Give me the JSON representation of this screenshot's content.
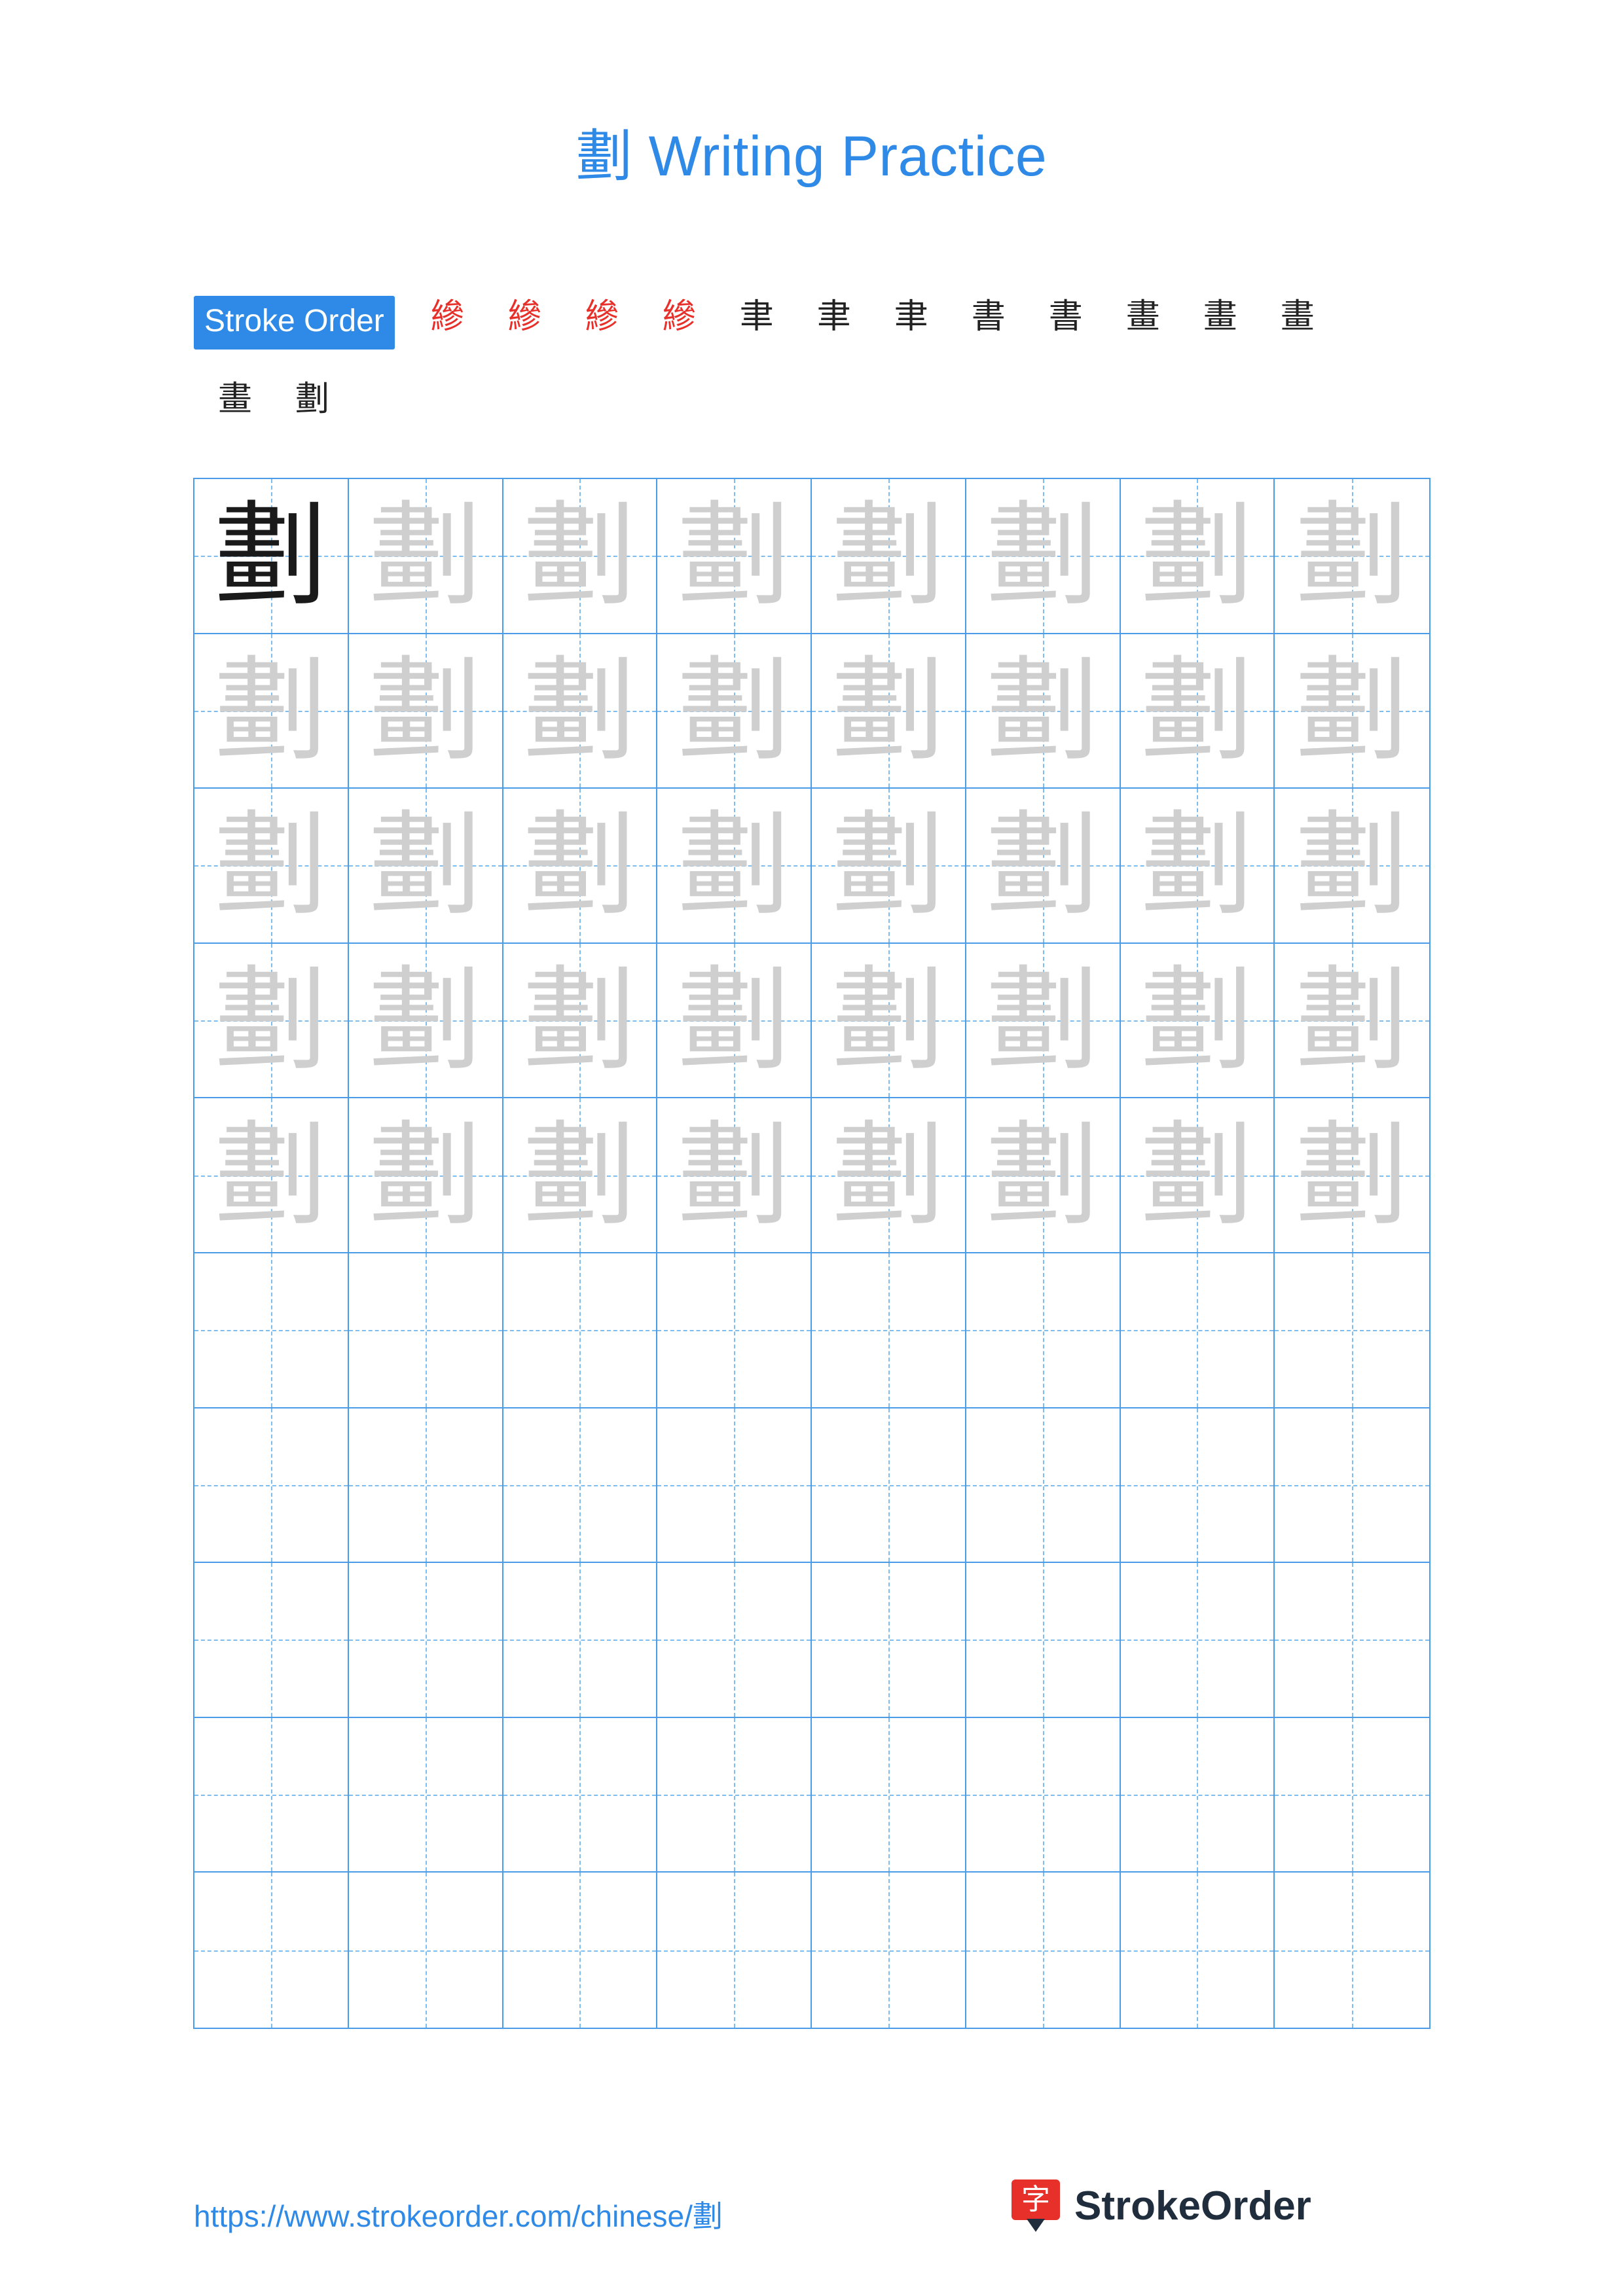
{
  "title": "劃 Writing Practice",
  "character": "劃",
  "stroke_order": {
    "label": "Stroke Order",
    "steps": [
      {
        "glyph": "縿",
        "color": "red"
      },
      {
        "glyph": "縿",
        "color": "red"
      },
      {
        "glyph": "縿",
        "color": "red"
      },
      {
        "glyph": "縿",
        "color": "red"
      },
      {
        "glyph": "聿",
        "color": "mixed"
      },
      {
        "glyph": "聿",
        "color": "mixed"
      },
      {
        "glyph": "聿",
        "color": "mixed"
      },
      {
        "glyph": "書",
        "color": "mixed"
      },
      {
        "glyph": "書",
        "color": "mixed"
      },
      {
        "glyph": "畫",
        "color": "mixed"
      },
      {
        "glyph": "畫",
        "color": "mixed"
      },
      {
        "glyph": "畫",
        "color": "mixed"
      },
      {
        "glyph": "畫",
        "color": "mixed"
      },
      {
        "glyph": "劃",
        "color": "mixed"
      }
    ]
  },
  "grid": {
    "columns": 8,
    "rows": 10,
    "filled_rows": 5,
    "first_cell_dark": true,
    "character": "劃"
  },
  "footer": {
    "url": "https://www.strokeorder.com/chinese/劃",
    "brand_name": "StrokeOrder",
    "brand_mark_char": "字"
  },
  "colors": {
    "accent": "#2e8ae6",
    "grid_line": "#4a9ce8",
    "grid_guide": "#7fbdee",
    "stroke_new": "#e8302a",
    "ghost_char": "#cfcfcf",
    "brand_red": "#e8302a",
    "brand_dark": "#1f2d3d"
  }
}
